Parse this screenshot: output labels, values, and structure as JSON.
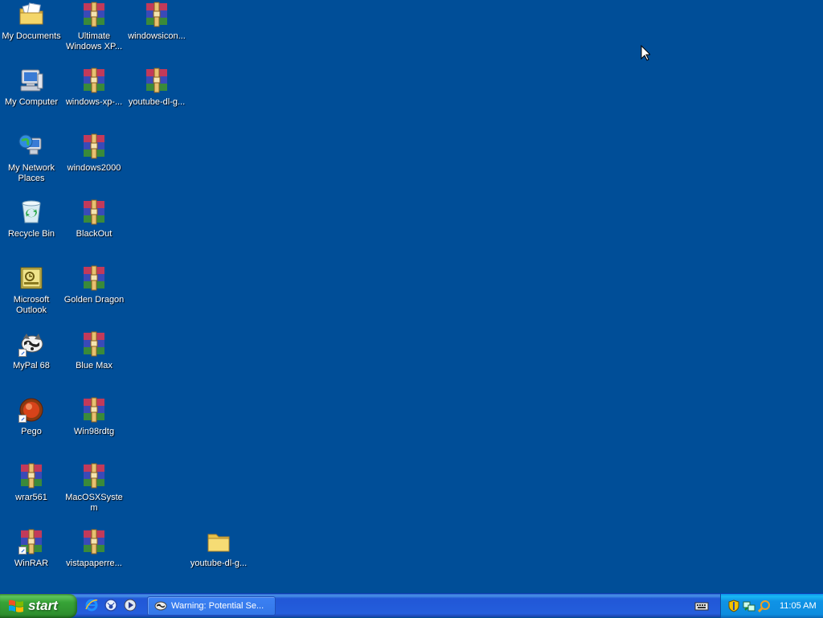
{
  "desktop": {
    "icons": [
      {
        "id": "my-documents",
        "label": "My Documents",
        "kind": "documents-folder-icon"
      },
      {
        "id": "my-computer",
        "label": "My Computer",
        "kind": "computer-icon"
      },
      {
        "id": "my-network-places",
        "label": "My Network Places",
        "kind": "network-globe-icon"
      },
      {
        "id": "recycle-bin",
        "label": "Recycle Bin",
        "kind": "recycle-bin-icon"
      },
      {
        "id": "microsoft-outlook",
        "label": "Microsoft Outlook",
        "kind": "outlook-icon"
      },
      {
        "id": "mypal-68",
        "label": "MyPal 68",
        "kind": "raccoon-browser-icon"
      },
      {
        "id": "pego",
        "label": "Pego",
        "kind": "red-ball-icon"
      },
      {
        "id": "wrar561",
        "label": "wrar561",
        "kind": "winrar-archive-icon"
      },
      {
        "id": "winrar",
        "label": "WinRAR",
        "kind": "winrar-archive-icon"
      },
      {
        "id": "ultimate-windows-xp",
        "label": "Ultimate Windows XP...",
        "kind": "winrar-archive-icon"
      },
      {
        "id": "windows-xp",
        "label": "windows-xp-...",
        "kind": "winrar-archive-icon"
      },
      {
        "id": "windows2000",
        "label": "windows2000",
        "kind": "winrar-archive-icon"
      },
      {
        "id": "blackout",
        "label": "BlackOut",
        "kind": "winrar-archive-icon"
      },
      {
        "id": "golden-dragon",
        "label": "Golden Dragon",
        "kind": "winrar-archive-icon"
      },
      {
        "id": "blue-max",
        "label": "Blue Max",
        "kind": "winrar-archive-icon"
      },
      {
        "id": "win98rdtg",
        "label": "Win98rdtg",
        "kind": "winrar-archive-icon"
      },
      {
        "id": "macosxsystem",
        "label": "MacOSXSystem",
        "kind": "winrar-archive-icon"
      },
      {
        "id": "vistapaperre",
        "label": "vistapaperre...",
        "kind": "winrar-archive-icon"
      },
      {
        "id": "windowsicon",
        "label": "windowsicon...",
        "kind": "winrar-archive-icon"
      },
      {
        "id": "youtube-dl-g-1",
        "label": "youtube-dl-g...",
        "kind": "winrar-archive-icon"
      },
      {
        "id": "youtube-dl-g-folder",
        "label": "youtube-dl-g...",
        "kind": "folder-icon"
      }
    ]
  },
  "taskbar": {
    "start_label": "start",
    "quick_launch": [
      "internet-explorer-icon",
      "browser-icon",
      "media-player-icon"
    ],
    "task_button_label": "Warning: Potential Se...",
    "clock": "11:05 AM"
  },
  "colors": {
    "desktop_bg": "#004e98",
    "taskbar_blue": "#245edc",
    "start_green": "#37a337",
    "tray_blue": "#0f93e6"
  }
}
